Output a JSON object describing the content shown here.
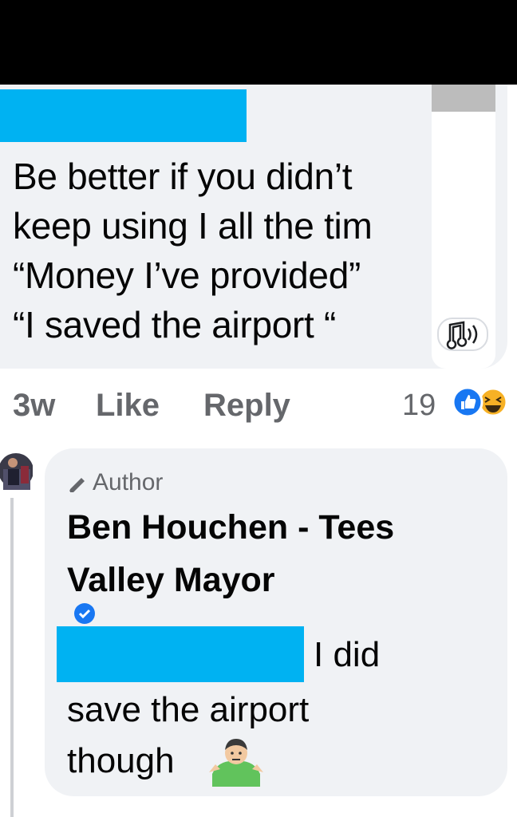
{
  "comment": {
    "text_lines": [
      "Be better if you didn’t",
      "keep using I all the tim",
      "“Money I’ve provided”",
      "“I saved the airport “"
    ],
    "time": "3w",
    "like_label": "Like",
    "reply_label": "Reply",
    "reaction_count": "19",
    "reactions": [
      "like-icon",
      "haha-icon"
    ]
  },
  "reply": {
    "author_badge": "Author",
    "author_name": "Ben Houchen - Tees Valley Mayor",
    "verified": true,
    "text_first": "I did",
    "text_rest": "save the airport\nthough",
    "emoji": "person-shrugging-emoji"
  },
  "colors": {
    "bubble": "#f0f2f5",
    "redaction": "#00b2f2",
    "meta_text": "#65676b",
    "like_blue": "#1877f2",
    "haha_yellow": "#f7b125"
  }
}
